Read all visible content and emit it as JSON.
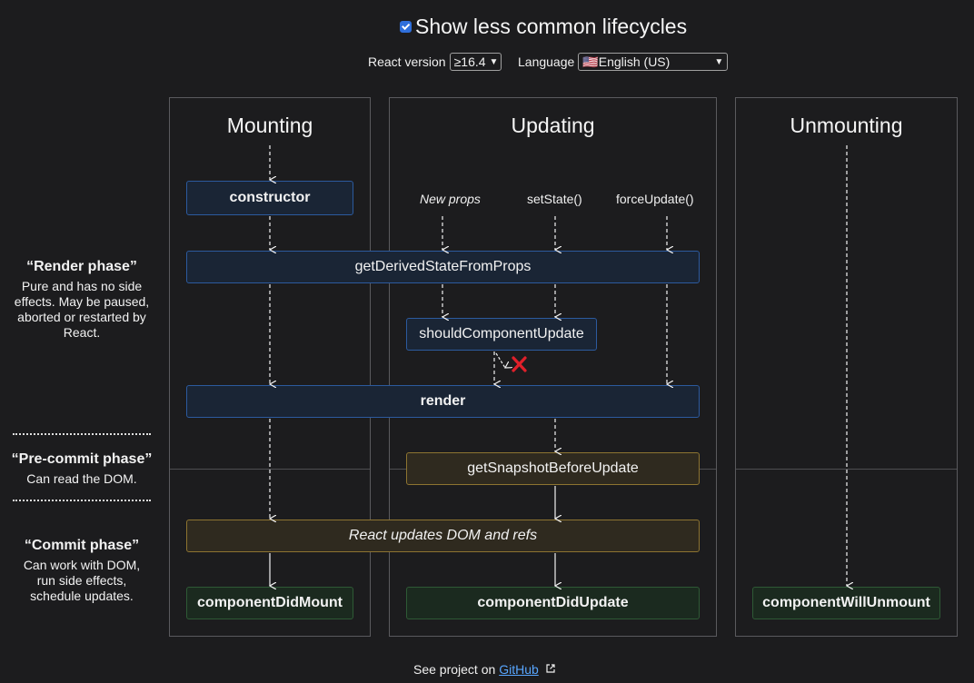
{
  "controls": {
    "show_less_common_label": "Show less common lifecycles",
    "show_less_common_checked": true,
    "react_version_label": "React version",
    "react_version_value": "≥16.4",
    "language_label": "Language",
    "language_value": "🇺🇸English (US)"
  },
  "columns": {
    "mounting": "Mounting",
    "updating": "Updating",
    "unmounting": "Unmounting"
  },
  "triggers": {
    "new_props": "New props",
    "set_state": "setState()",
    "force_update": "forceUpdate()"
  },
  "methods": {
    "constructor": "constructor",
    "get_derived_state": "getDerivedStateFromProps",
    "should_component_update": "shouldComponentUpdate",
    "render": "render",
    "get_snapshot": "getSnapshotBeforeUpdate",
    "react_updates_dom": "React updates DOM and refs",
    "component_did_mount": "componentDidMount",
    "component_did_update": "componentDidUpdate",
    "component_will_unmount": "componentWillUnmount"
  },
  "phases": {
    "render": {
      "title": "“Render phase”",
      "description": "Pure and has no side effects. May be paused, aborted or restarted by React."
    },
    "pre_commit": {
      "title": "“Pre-commit phase”",
      "description": "Can read the DOM."
    },
    "commit": {
      "title": "“Commit phase”",
      "description": "Can work with DOM, run side effects, schedule updates."
    }
  },
  "footer": {
    "prefix": "See project on",
    "link_text": "GitHub"
  },
  "colors": {
    "background": "#1c1c1e",
    "render_box": "#1a2535",
    "pre_commit_box": "#2f2a1f",
    "commit_box": "#1b2a1f",
    "cancel_mark": "#e0202a",
    "link": "#58a6ff"
  },
  "icons": {
    "cancel": "red-x-icon",
    "external": "external-link-icon"
  }
}
